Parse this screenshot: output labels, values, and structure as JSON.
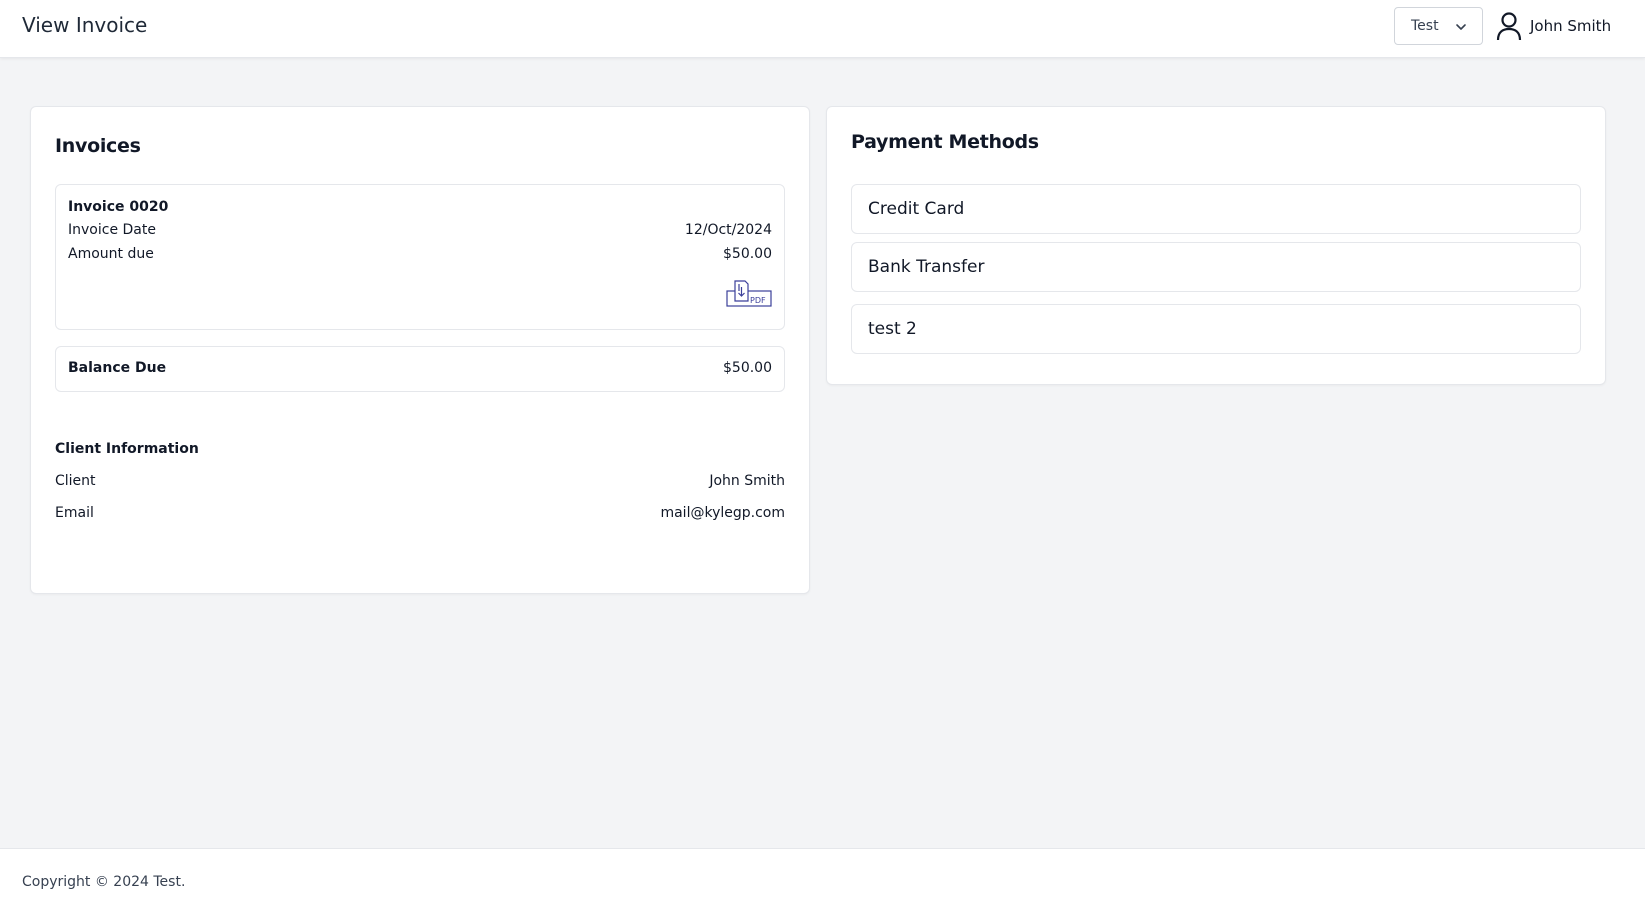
{
  "header": {
    "title": "View Invoice",
    "org_select": {
      "value": "Test"
    },
    "user": {
      "name": "John Smith"
    }
  },
  "invoices": {
    "title": "Invoices",
    "invoice": {
      "number": "Invoice 0020",
      "date_label": "Invoice Date",
      "date_value": "12/Oct/2024",
      "amount_label": "Amount due",
      "amount_value": "$50.00",
      "pdf_icon": "pdf-download-icon"
    },
    "balance": {
      "label": "Balance Due",
      "value": "$50.00"
    },
    "client_info": {
      "title": "Client Information",
      "client_label": "Client",
      "client_value": "John Smith",
      "email_label": "Email",
      "email_value": "mail@kylegp.com"
    }
  },
  "payment_methods": {
    "title": "Payment Methods",
    "items": [
      {
        "label": "Credit Card"
      },
      {
        "label": "Bank Transfer"
      },
      {
        "label": "test 2"
      }
    ]
  },
  "footer": {
    "copyright": "Copyright © 2024 Test."
  },
  "colors": {
    "pdf_icon": "#3b3f9a",
    "border": "#e5e7eb",
    "background": "#f3f4f6"
  }
}
